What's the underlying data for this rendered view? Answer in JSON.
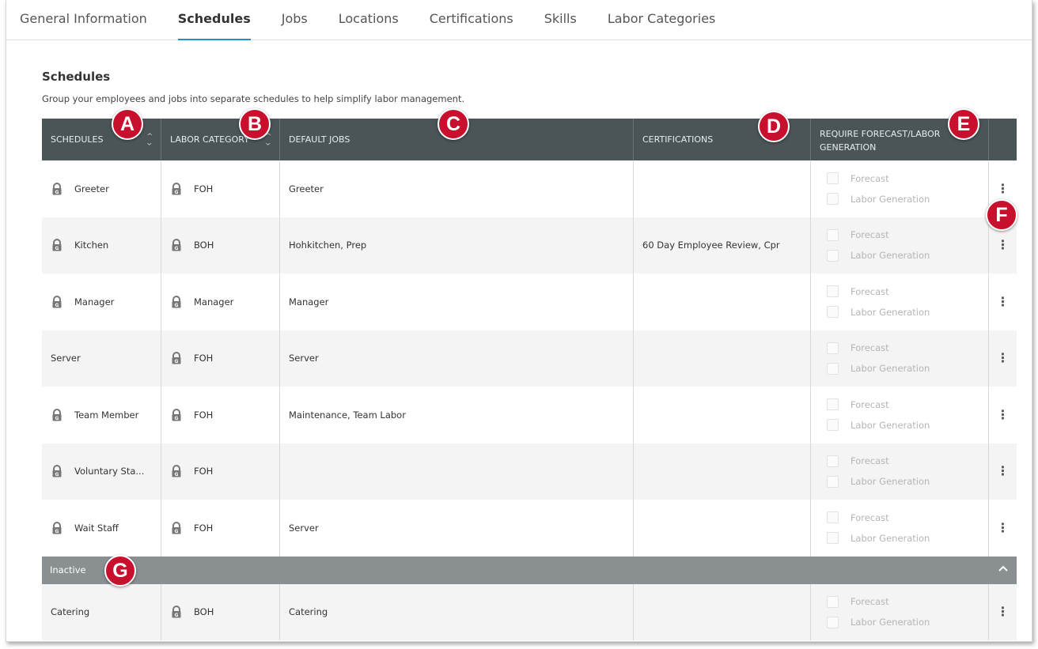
{
  "tabs": [
    {
      "label": "General Information",
      "active": false
    },
    {
      "label": "Schedules",
      "active": true
    },
    {
      "label": "Jobs",
      "active": false
    },
    {
      "label": "Locations",
      "active": false
    },
    {
      "label": "Certifications",
      "active": false
    },
    {
      "label": "Skills",
      "active": false
    },
    {
      "label": "Labor Categories",
      "active": false
    }
  ],
  "section": {
    "title": "Schedules",
    "description": "Group your employees and jobs into separate schedules to help simplify labor management."
  },
  "table": {
    "headers": {
      "schedules": "SCHEDULES",
      "labor_category": "LABOR CATEGORY",
      "default_jobs": "DEFAULT JOBS",
      "certifications": "CERTIFICATIONS",
      "require": "REQUIRE FORECAST/LABOR GENERATION"
    },
    "checkbox_labels": {
      "forecast": "Forecast",
      "labor_generation": "Labor Generation"
    },
    "rows": [
      {
        "schedule": "Greeter",
        "schedule_locked": true,
        "category": "FOH",
        "jobs": "Greeter",
        "certs": ""
      },
      {
        "schedule": "Kitchen",
        "schedule_locked": true,
        "category": "BOH",
        "jobs": "Hohkitchen, Prep",
        "certs": "60 Day Employee Review, Cpr"
      },
      {
        "schedule": "Manager",
        "schedule_locked": true,
        "category": "Manager",
        "jobs": "Manager",
        "certs": ""
      },
      {
        "schedule": "Server",
        "schedule_locked": false,
        "category": "FOH",
        "jobs": "Server",
        "certs": ""
      },
      {
        "schedule": "Team Member",
        "schedule_locked": true,
        "category": "FOH",
        "jobs": "Maintenance, Team Labor",
        "certs": ""
      },
      {
        "schedule": "Voluntary Sta...",
        "schedule_locked": true,
        "category": "FOH",
        "jobs": "",
        "certs": ""
      },
      {
        "schedule": "Wait Staff",
        "schedule_locked": true,
        "category": "FOH",
        "jobs": "Server",
        "certs": ""
      }
    ],
    "inactive_label": "Inactive",
    "inactive_rows": [
      {
        "schedule": "Catering",
        "schedule_locked": false,
        "category": "BOH",
        "jobs": "Catering",
        "certs": ""
      }
    ]
  },
  "callouts": [
    "A",
    "B",
    "C",
    "D",
    "E",
    "F",
    "G"
  ],
  "colors": {
    "accent": "#1a8fc9",
    "header_bg": "#4a5557",
    "callout": "#c8102e",
    "inactive_bar": "#8a8f92"
  }
}
